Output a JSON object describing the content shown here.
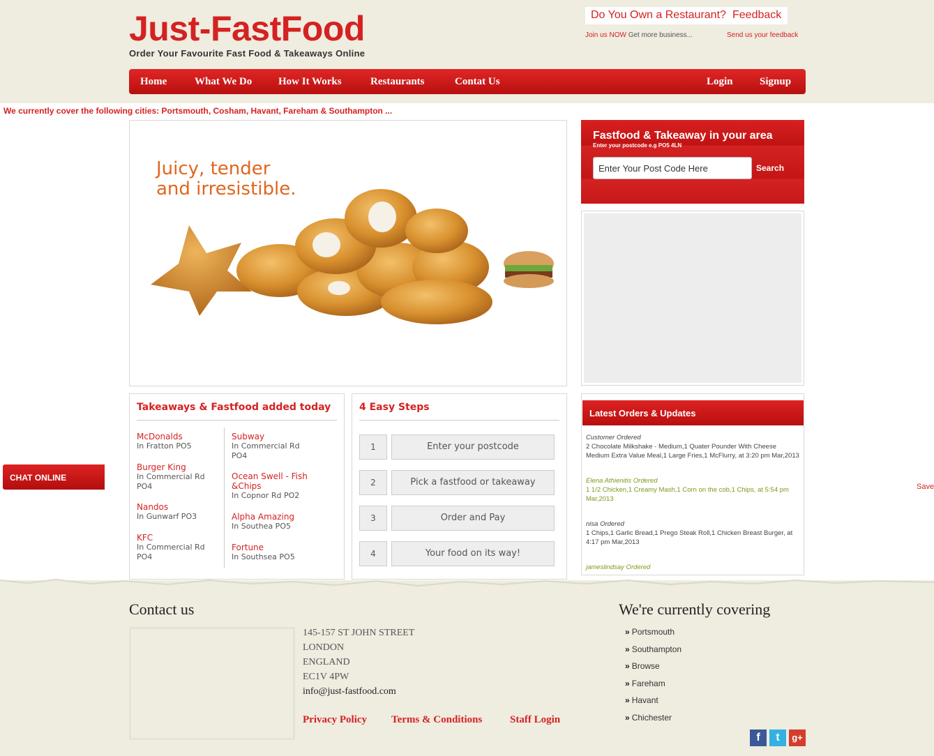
{
  "header": {
    "logo": "Just-FastFood",
    "tagline": "Order Your Favourite Fast Food & Takeaways Online",
    "restaurant_link": "Do You Own a Restaurant?",
    "restaurant_sub_red": "Join us",
    "restaurant_sub_now": "NOW",
    "restaurant_sub_grey": "Get more business...",
    "feedback_link": "Feedback",
    "feedback_sub": "Send us your feedback"
  },
  "nav": {
    "items": [
      "Home",
      "What We Do",
      "How It Works",
      "Restaurants",
      "Contat Us"
    ],
    "login": "Login",
    "signup": "Signup"
  },
  "cities_notice": "We currently cover the following cities: Portsmouth, Cosham, Havant, Fareham & Southampton ...",
  "hero": {
    "line1": "Juicy, tender",
    "line2": "and irresistible."
  },
  "postcode": {
    "title": "Fastfood & Takeaway in your area",
    "subtitle": "Enter your postcode e.g PO5 4LN",
    "input_value": "Enter Your Post Code Here",
    "button": "Search"
  },
  "takeaways": {
    "title": "Takeaways & Fastfood added today",
    "left": [
      {
        "name": "McDonalds",
        "addr": "In Fratton PO5"
      },
      {
        "name": "Burger King",
        "addr": "In Commercial Rd PO4"
      },
      {
        "name": "Nandos",
        "addr": "In Gunwarf PO3"
      },
      {
        "name": "KFC",
        "addr": "In Commercial Rd PO4"
      }
    ],
    "right": [
      {
        "name": "Subway",
        "addr": "In Commercial Rd PO4"
      },
      {
        "name": "Ocean Swell - Fish &Chips",
        "addr": "In Copnor Rd PO2"
      },
      {
        "name": "Alpha Amazing",
        "addr": "In Southea PO5"
      },
      {
        "name": "Fortune",
        "addr": "In Southsea PO5"
      }
    ]
  },
  "steps": {
    "title": "4 Easy Steps",
    "items": [
      {
        "num": "1",
        "label": "Enter your postcode"
      },
      {
        "num": "2",
        "label": "Pick a fastfood or takeaway"
      },
      {
        "num": "3",
        "label": "Order and Pay"
      },
      {
        "num": "4",
        "label": "Your food on its way!"
      }
    ]
  },
  "orders": {
    "title": "Latest Orders & Updates",
    "items": [
      {
        "who": "Customer Ordered",
        "text": "2 Chocolate Milkshake - Medium,1 Quater Pounder With Cheese Medium Extra Value Meal,1 Large Fries,1 McFlurry, at 3:20 pm Mar,2013",
        "color": "grey"
      },
      {
        "who": "Elena Athienitis Ordered",
        "text": "1 1/2 Chicken,1 Creamy Mash,1 Corn on the cob,1 Chips, at 5:54 pm Mar,2013",
        "color": "green"
      },
      {
        "who": "nisa Ordered",
        "text": "1 Chips,1 Garlic Bread,1 Prego Steak Roll,1 Chicken Breast Burger, at 4:17 pm Mar,2013",
        "color": "grey"
      },
      {
        "who": "jameslindsay Ordered",
        "text": "",
        "color": "green"
      }
    ]
  },
  "chat": {
    "label": "CHAT ONLINE"
  },
  "save": "Save",
  "footer": {
    "contact_title": "Contact us",
    "address": [
      "145-157 ST JOHN STREET",
      "LONDON",
      "ENGLAND",
      "EC1V 4PW"
    ],
    "email": "info@just-fastfood.com",
    "links": [
      "Privacy Policy",
      "Terms & Conditions",
      "Staff Login"
    ],
    "covering_title": "We're currently covering",
    "covering": [
      "Portsmouth",
      "Southampton",
      "Browse",
      "Fareham",
      "Havant",
      "Chichester"
    ],
    "social": {
      "facebook": "f",
      "twitter": "t",
      "google": "g+"
    }
  },
  "colors": {
    "brand_red": "#d42222",
    "cream": "#efece0",
    "order_green": "#7a9a1a",
    "hero_orange": "#e0661e"
  }
}
